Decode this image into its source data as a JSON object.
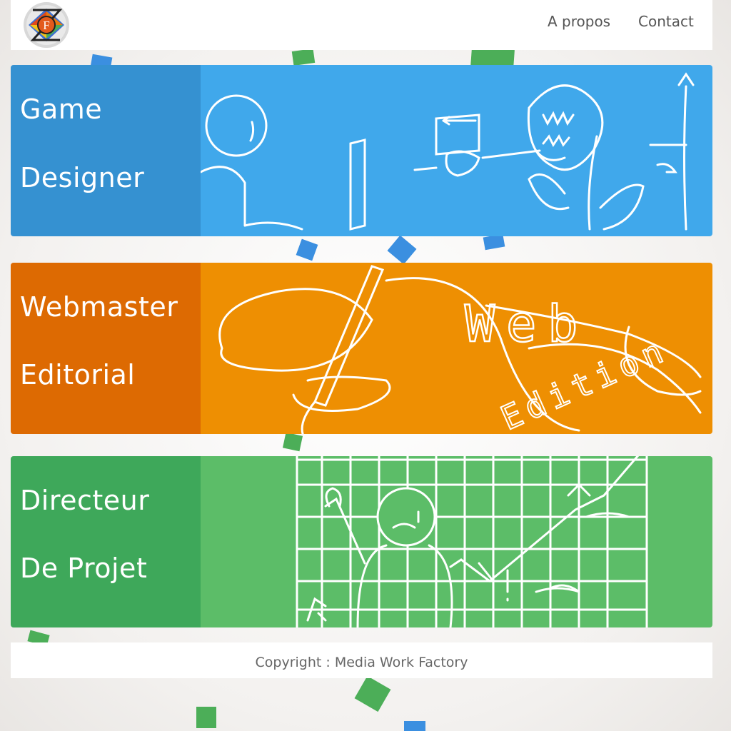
{
  "header": {
    "logo_letter": "F",
    "nav": [
      {
        "label": "A propos"
      },
      {
        "label": "Contact"
      }
    ]
  },
  "panels": [
    {
      "lines": [
        "Game",
        "Designer"
      ],
      "label_color": "#3591d1",
      "art_color": "#40a8eb"
    },
    {
      "lines": [
        "Webmaster",
        "Editorial"
      ],
      "label_color": "#dd6a02",
      "art_color": "#ee8f02",
      "art_text": {
        "word1": "Web",
        "word2": "Edition"
      }
    },
    {
      "lines": [
        "Directeur",
        "De Projet"
      ],
      "label_color": "#3ea85a",
      "art_color": "#5cbd68"
    }
  ],
  "footer": {
    "copyright": "Copyright : Media Work Factory"
  }
}
